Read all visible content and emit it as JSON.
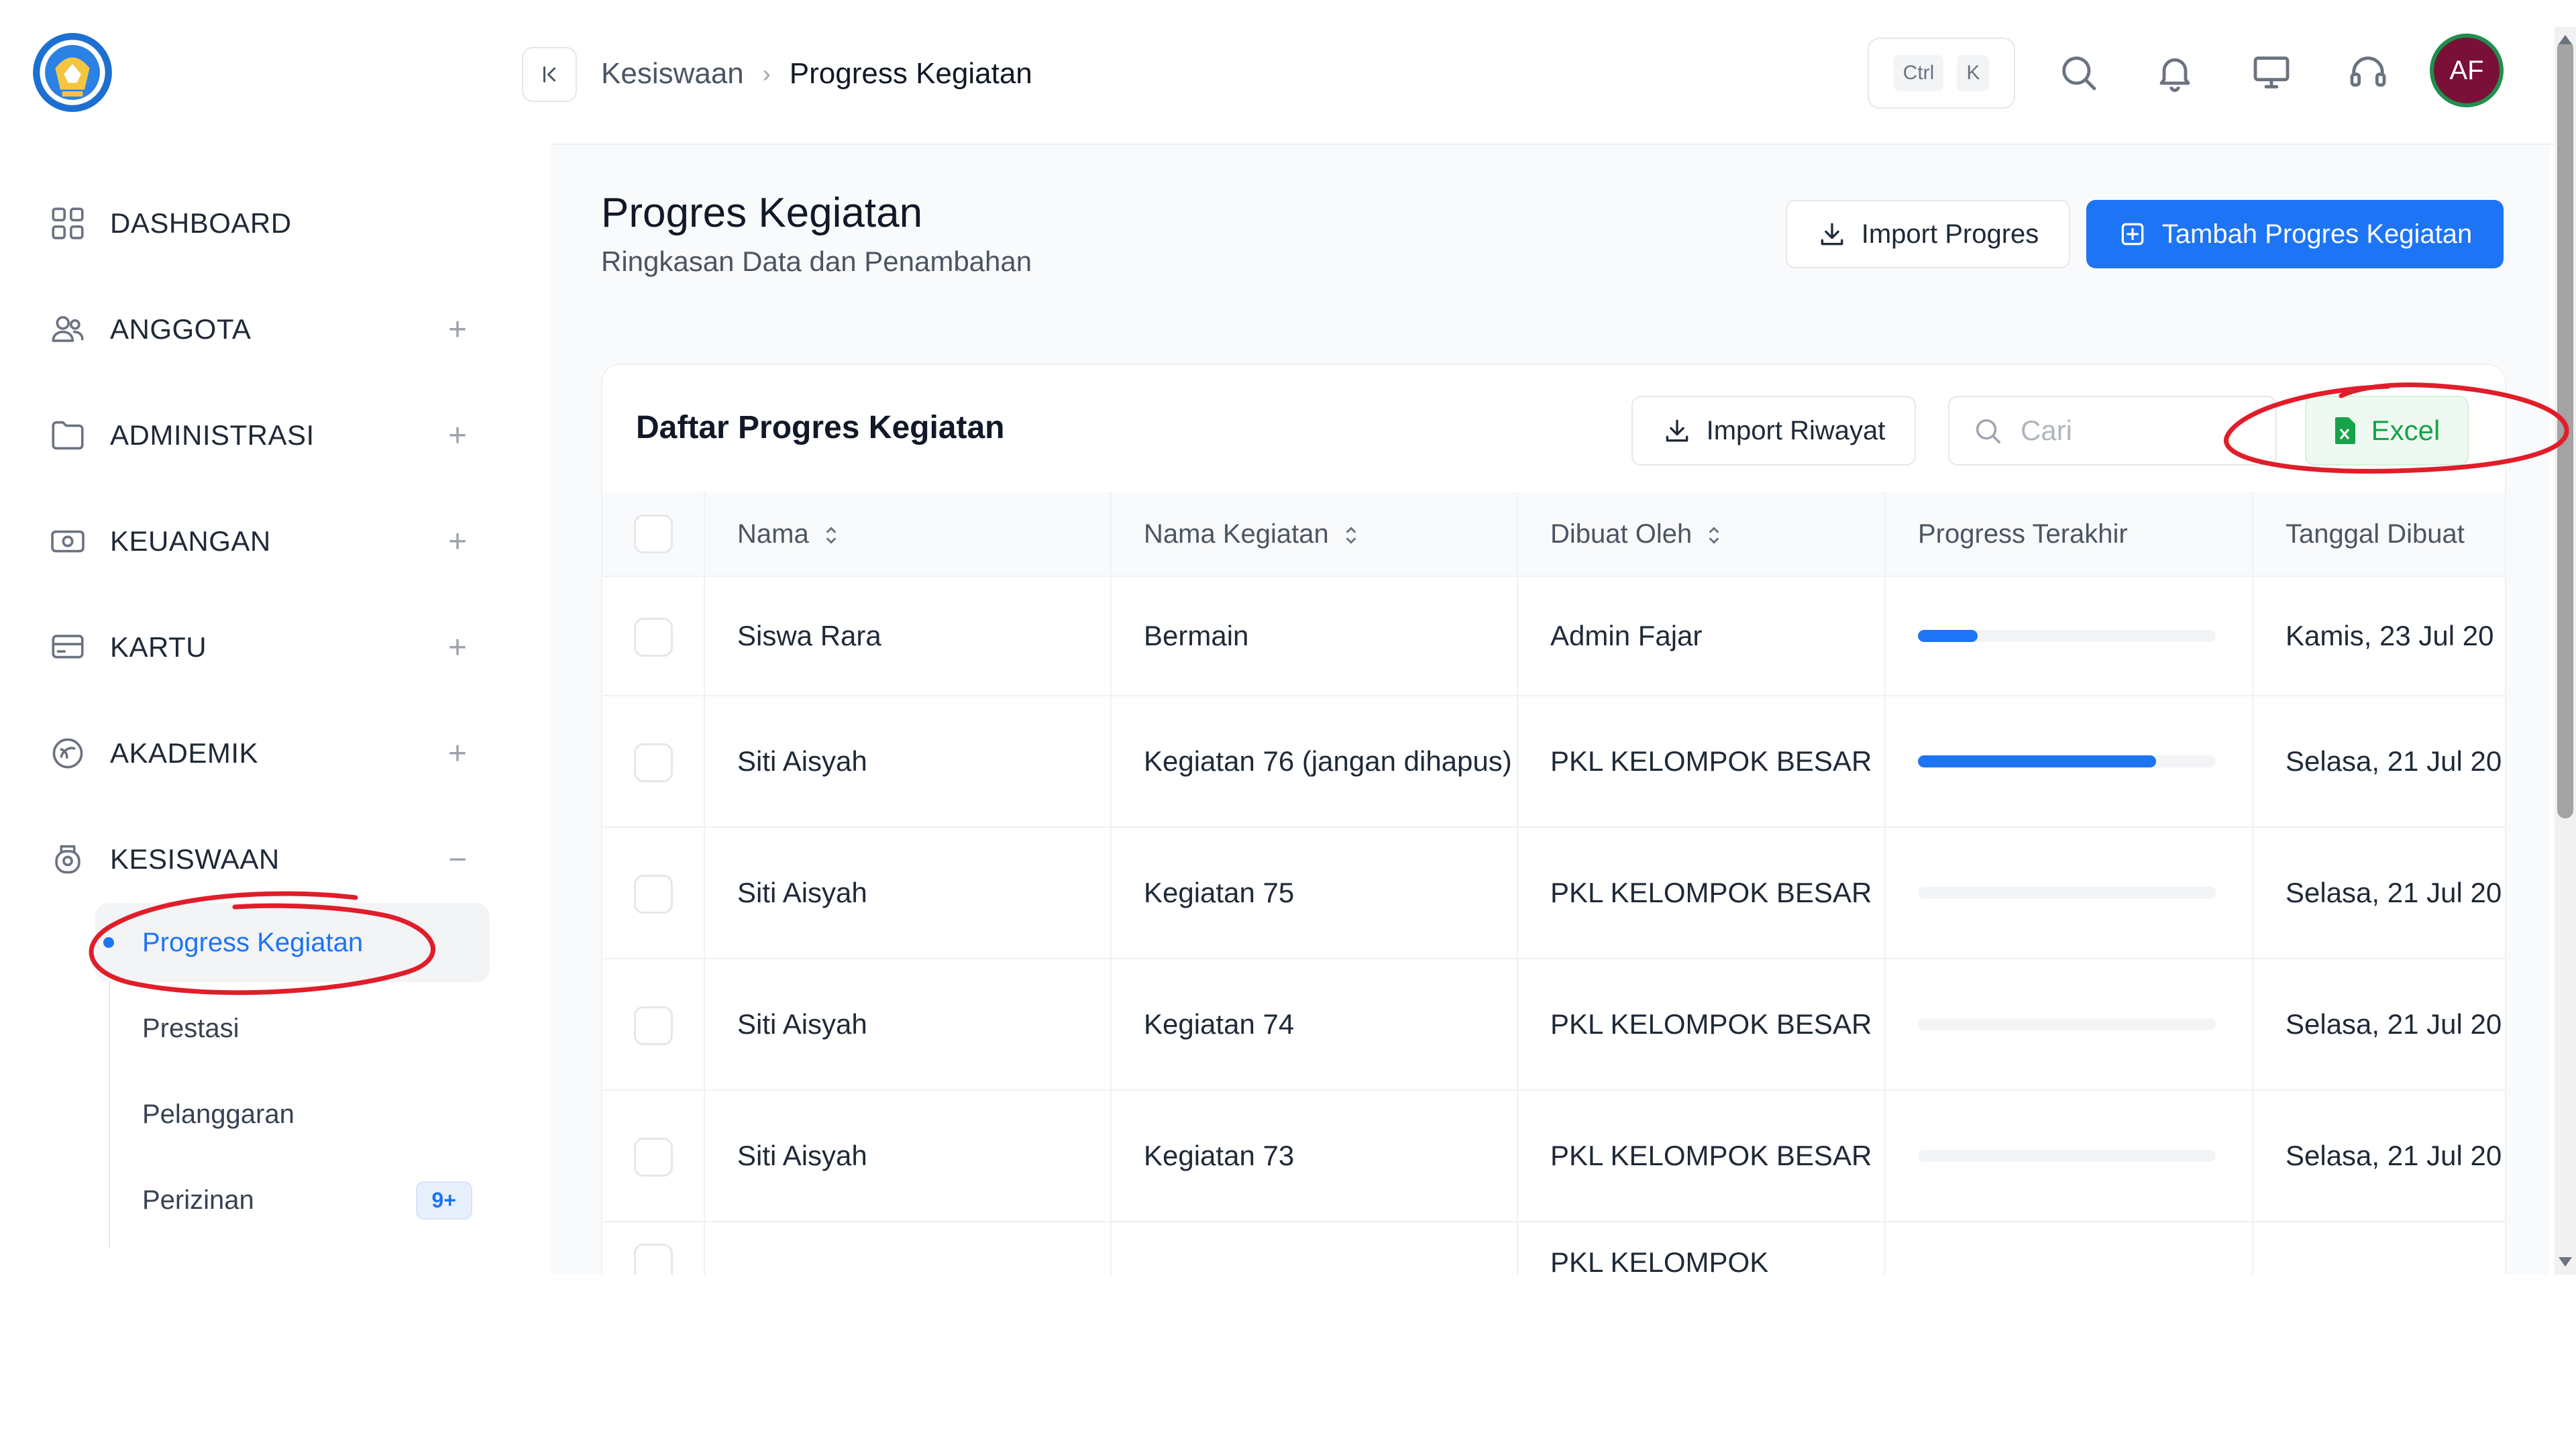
{
  "sidebar": {
    "items": [
      {
        "label": "DASHBOARD",
        "icon": "dashboard-grid-icon",
        "expandable": false
      },
      {
        "label": "ANGGOTA",
        "icon": "users-icon",
        "expandable": true,
        "toggle": "+"
      },
      {
        "label": "ADMINISTRASI",
        "icon": "folder-icon",
        "expandable": true,
        "toggle": "+"
      },
      {
        "label": "KEUANGAN",
        "icon": "money-icon",
        "expandable": true,
        "toggle": "+"
      },
      {
        "label": "KARTU",
        "icon": "card-icon",
        "expandable": true,
        "toggle": "+"
      },
      {
        "label": "AKADEMIK",
        "icon": "academic-icon",
        "expandable": true,
        "toggle": "+"
      },
      {
        "label": "KESISWAAN",
        "icon": "student-icon",
        "expandable": true,
        "toggle": "−"
      }
    ],
    "subitems": [
      {
        "label": "Progress Kegiatan",
        "active": true
      },
      {
        "label": "Prestasi"
      },
      {
        "label": "Pelanggaran"
      },
      {
        "label": "Perizinan",
        "badge": "9+"
      }
    ]
  },
  "header": {
    "breadcrumb": [
      "Kesiswaan",
      "Progress Kegiatan"
    ],
    "shortcut": [
      "Ctrl",
      "K"
    ],
    "avatar_initials": "AF"
  },
  "page": {
    "title": "Progres Kegiatan",
    "subtitle": "Ringkasan Data dan Penambahan",
    "import_button": "Import Progres",
    "add_button": "Tambah Progres Kegiatan"
  },
  "card": {
    "title": "Daftar Progres Kegiatan",
    "import_history_button": "Import Riwayat",
    "search_placeholder": "Cari",
    "excel_button": "Excel"
  },
  "table": {
    "columns": [
      "Nama",
      "Nama Kegiatan",
      "Dibuat Oleh",
      "Progress Terakhir",
      "Tanggal Dibuat"
    ],
    "rows": [
      {
        "nama": "Siswa Rara",
        "kegiatan": "Bermain",
        "dibuat_oleh": "Admin Fajar",
        "progress": 0.2,
        "tanggal": "Kamis, 23 Jul 20"
      },
      {
        "nama": "Siti Aisyah",
        "kegiatan": "Kegiatan 76 (jangan dihapus)",
        "dibuat_oleh": "PKL KELOMPOK BESAR",
        "progress": 0.8,
        "tanggal": "Selasa, 21 Jul 20"
      },
      {
        "nama": "Siti Aisyah",
        "kegiatan": "Kegiatan 75",
        "dibuat_oleh": "PKL KELOMPOK BESAR",
        "progress": 0,
        "tanggal": "Selasa, 21 Jul 20"
      },
      {
        "nama": "Siti Aisyah",
        "kegiatan": "Kegiatan 74",
        "dibuat_oleh": "PKL KELOMPOK BESAR",
        "progress": 0,
        "tanggal": "Selasa, 21 Jul 20"
      },
      {
        "nama": "Siti Aisyah",
        "kegiatan": "Kegiatan 73",
        "dibuat_oleh": "PKL KELOMPOK BESAR",
        "progress": 0,
        "tanggal": "Selasa, 21 Jul 20"
      },
      {
        "nama": "",
        "kegiatan": "",
        "dibuat_oleh": "PKL KELOMPOK",
        "progress": 0,
        "tanggal": ""
      }
    ]
  },
  "colors": {
    "accent": "#1d74f5",
    "excel_green": "#16a34a",
    "annotation_red": "#e11d2a",
    "avatar_bg": "#7a1037"
  }
}
